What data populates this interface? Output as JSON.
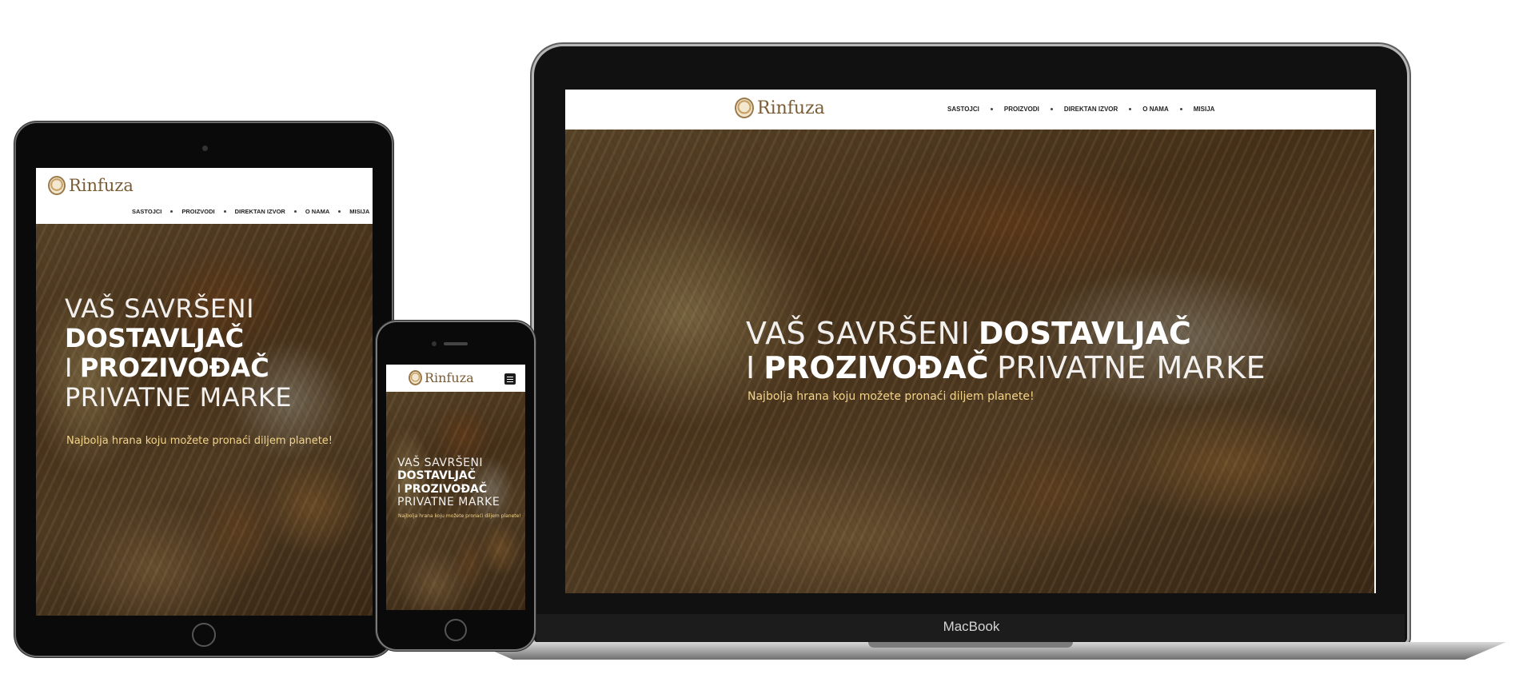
{
  "brand": {
    "name": "Rinfuza"
  },
  "nav": {
    "items": [
      {
        "label": "SASTOJCI"
      },
      {
        "label": "PROIZVODI"
      },
      {
        "label": "DIREKTAN IZVOR"
      },
      {
        "label": "O NAMA"
      },
      {
        "label": "MISIJA"
      }
    ]
  },
  "hero": {
    "line1_thin": "VAŠ SAVRŠENI",
    "bold1": "DOSTAVLJAČ",
    "sep": "I",
    "bold2": "PROZIVOĐAČ",
    "thin2": "PRIVATNE MARKE",
    "subtitle": "Najbolja hrana koju možete pronaći diljem planete!"
  },
  "device": {
    "laptop_brand": "MacBook"
  },
  "colors": {
    "accent": "#f3d489",
    "logo": "#7a5c35",
    "nav_text": "#222222"
  },
  "icons": {
    "logo": "wheat-logo-icon",
    "menu": "hamburger-menu-icon"
  }
}
